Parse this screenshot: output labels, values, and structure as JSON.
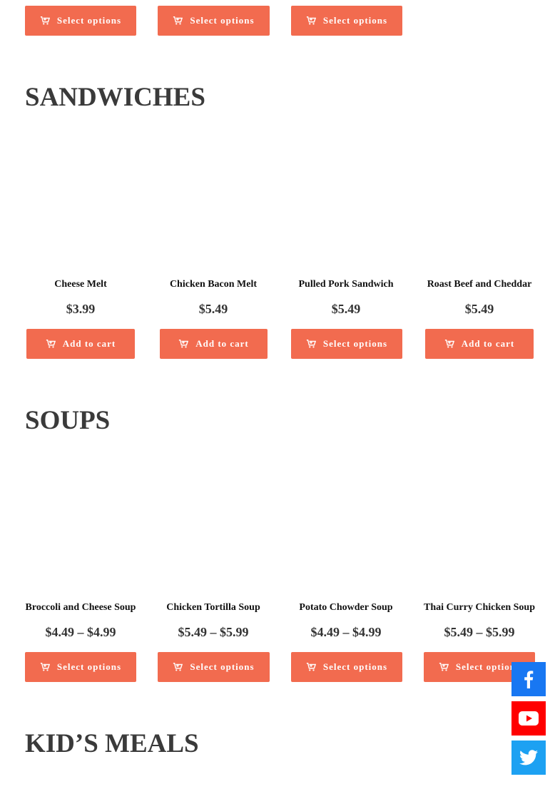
{
  "top_row": {
    "buttons": [
      "Select options",
      "Select options",
      "Select options"
    ]
  },
  "sandwiches": {
    "title": "SANDWICHES",
    "products": [
      {
        "name": "Cheese Melt",
        "price": "$3.99",
        "button": "Add to cart"
      },
      {
        "name": "Chicken Bacon Melt",
        "price": "$5.49",
        "button": "Add to cart"
      },
      {
        "name": "Pulled Pork Sandwich",
        "price": "$5.49",
        "button": "Select options"
      },
      {
        "name": "Roast Beef and Cheddar",
        "price": "$5.49",
        "button": "Add to cart"
      }
    ]
  },
  "soups": {
    "title": "SOUPS",
    "products": [
      {
        "name": "Broccoli and Cheese Soup",
        "price": "$4.49 – $4.99",
        "button": "Select options"
      },
      {
        "name": "Chicken Tortilla Soup",
        "price": "$5.49 – $5.99",
        "button": "Select options"
      },
      {
        "name": "Potato Chowder Soup",
        "price": "$4.49 – $4.99",
        "button": "Select options"
      },
      {
        "name": "Thai Curry Chicken Soup",
        "price": "$5.49 – $5.99",
        "button": "Select options"
      }
    ]
  },
  "kids_meals": {
    "title": "KID’S MEALS"
  },
  "social": {
    "items": [
      {
        "icon": "facebook-icon",
        "color": "#1877f2"
      },
      {
        "icon": "youtube-icon",
        "color": "#ff0000"
      },
      {
        "icon": "twitter-icon",
        "color": "#1da1f2"
      }
    ]
  },
  "colors": {
    "button": "#f26b4f",
    "heading": "#3a3a3a"
  }
}
